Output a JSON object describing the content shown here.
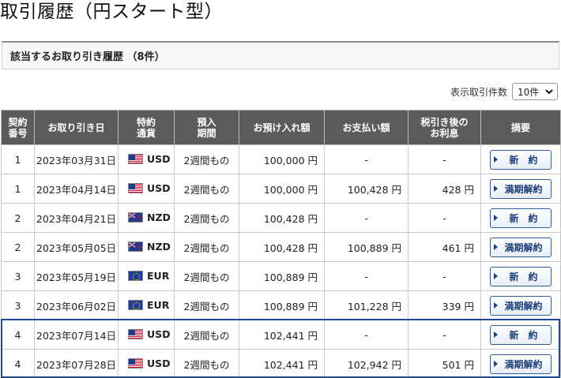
{
  "page": {
    "title": "取引履歴（円スタート型）"
  },
  "subheader": {
    "label": "該当するお取り引き履歴 （8件）"
  },
  "pager": {
    "label": "表示取引件数",
    "selected": "10件"
  },
  "table": {
    "headers": {
      "contract_no": "契約\n番号",
      "date": "お取り引き日",
      "currency": "特約\n通貨",
      "period": "預入\n期間",
      "deposit": "お預け入れ額",
      "payment": "お支払い額",
      "interest": "税引き後の\nお利息",
      "summary": "摘要"
    },
    "rows": [
      {
        "no": "1",
        "date": "2023年03月31日",
        "currency": "USD",
        "flag": "us-flag-icon",
        "period": "2週間もの",
        "deposit": "100,000 円",
        "payment": "-",
        "interest": "-",
        "action": "新　約"
      },
      {
        "no": "1",
        "date": "2023年04月14日",
        "currency": "USD",
        "flag": "us-flag-icon",
        "period": "2週間もの",
        "deposit": "100,000 円",
        "payment": "100,428 円",
        "interest": "428 円",
        "action": "満期解約"
      },
      {
        "no": "2",
        "date": "2023年04月21日",
        "currency": "NZD",
        "flag": "nz-flag-icon",
        "period": "2週間もの",
        "deposit": "100,428 円",
        "payment": "-",
        "interest": "-",
        "action": "新　約"
      },
      {
        "no": "2",
        "date": "2023年05月05日",
        "currency": "NZD",
        "flag": "nz-flag-icon",
        "period": "2週間もの",
        "deposit": "100,428 円",
        "payment": "100,889 円",
        "interest": "461 円",
        "action": "満期解約"
      },
      {
        "no": "3",
        "date": "2023年05月19日",
        "currency": "EUR",
        "flag": "eu-flag-icon",
        "period": "2週間もの",
        "deposit": "100,889 円",
        "payment": "-",
        "interest": "-",
        "action": "新　約"
      },
      {
        "no": "3",
        "date": "2023年06月02日",
        "currency": "EUR",
        "flag": "eu-flag-icon",
        "period": "2週間もの",
        "deposit": "100,889 円",
        "payment": "101,228 円",
        "interest": "339 円",
        "action": "満期解約"
      },
      {
        "no": "4",
        "date": "2023年07月14日",
        "currency": "USD",
        "flag": "us-flag-icon",
        "period": "2週間もの",
        "deposit": "102,441 円",
        "payment": "-",
        "interest": "-",
        "action": "新　約"
      },
      {
        "no": "4",
        "date": "2023年07月28日",
        "currency": "USD",
        "flag": "us-flag-icon",
        "period": "2週間もの",
        "deposit": "102,441 円",
        "payment": "102,942 円",
        "interest": "501 円",
        "action": "満期解約"
      }
    ]
  },
  "colors": {
    "header_bg": "#5b5b5b",
    "button_border": "#2f5f9e",
    "highlight": "#1d4b8f"
  }
}
